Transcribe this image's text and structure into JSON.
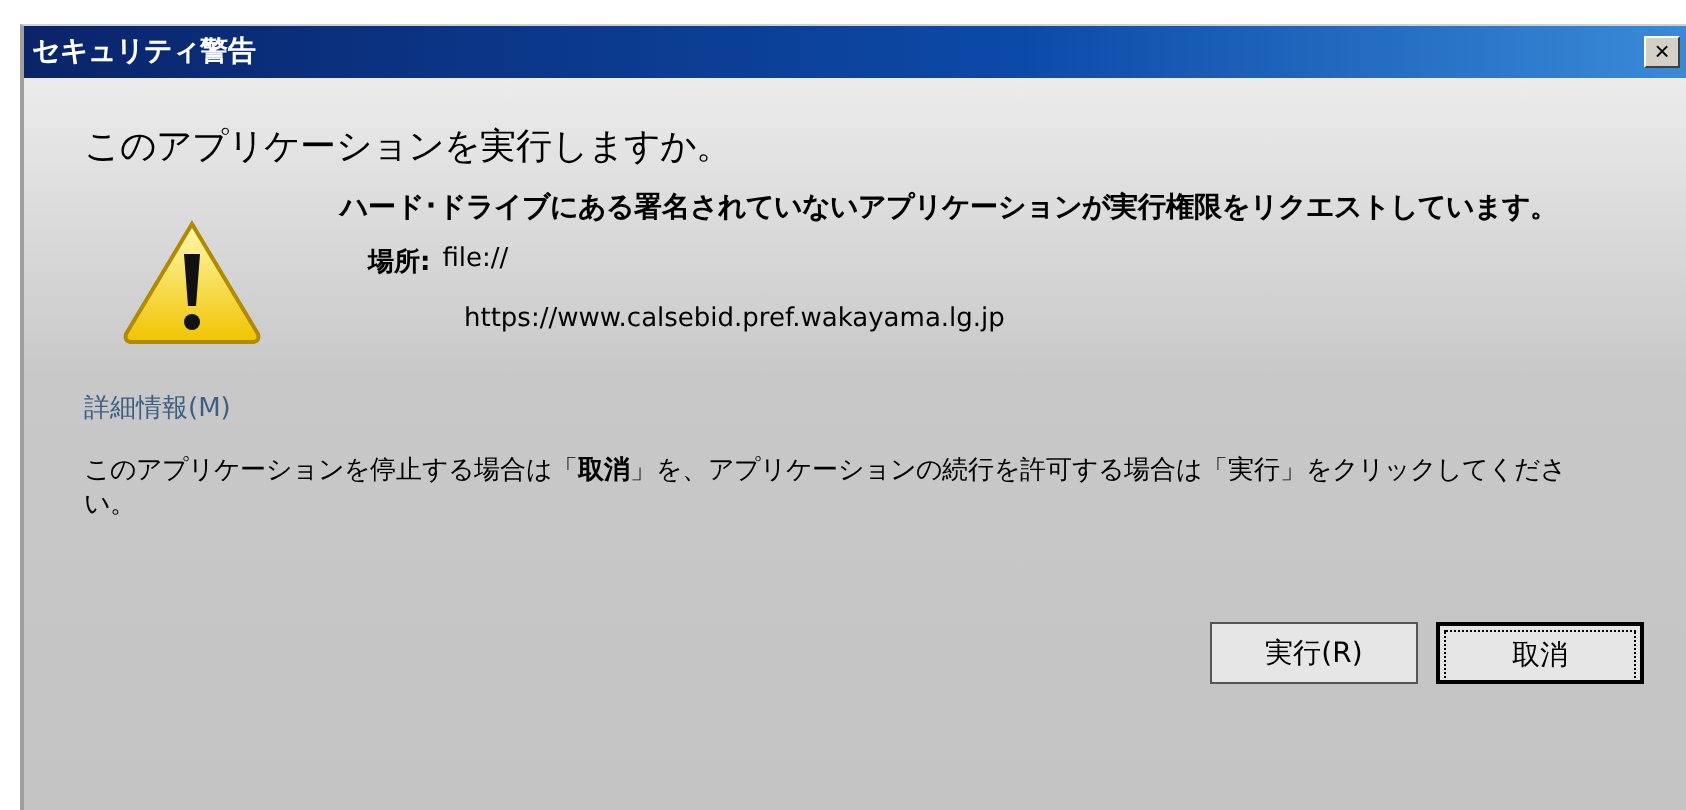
{
  "window": {
    "title": "セキュリティ警告",
    "close": "×"
  },
  "heading": "このアプリケーションを実行しますか。",
  "message": "ハード･ドライブにある署名されていないアプリケーションが実行権限をリクエストしています。",
  "location": {
    "label": "場所:",
    "value": "file://",
    "url": "https://www.calsebid.pref.wakayama.lg.jp"
  },
  "details_link": "詳細情報(M)",
  "instruction": "このアプリケーションを停止する場合は「**取消**」を、アプリケーションの続行を許可する場合は「実行」をクリックしてください。",
  "buttons": [
    {
      "label": "実行(R)",
      "focused": false
    },
    {
      "label": "取消",
      "focused": true
    }
  ]
}
